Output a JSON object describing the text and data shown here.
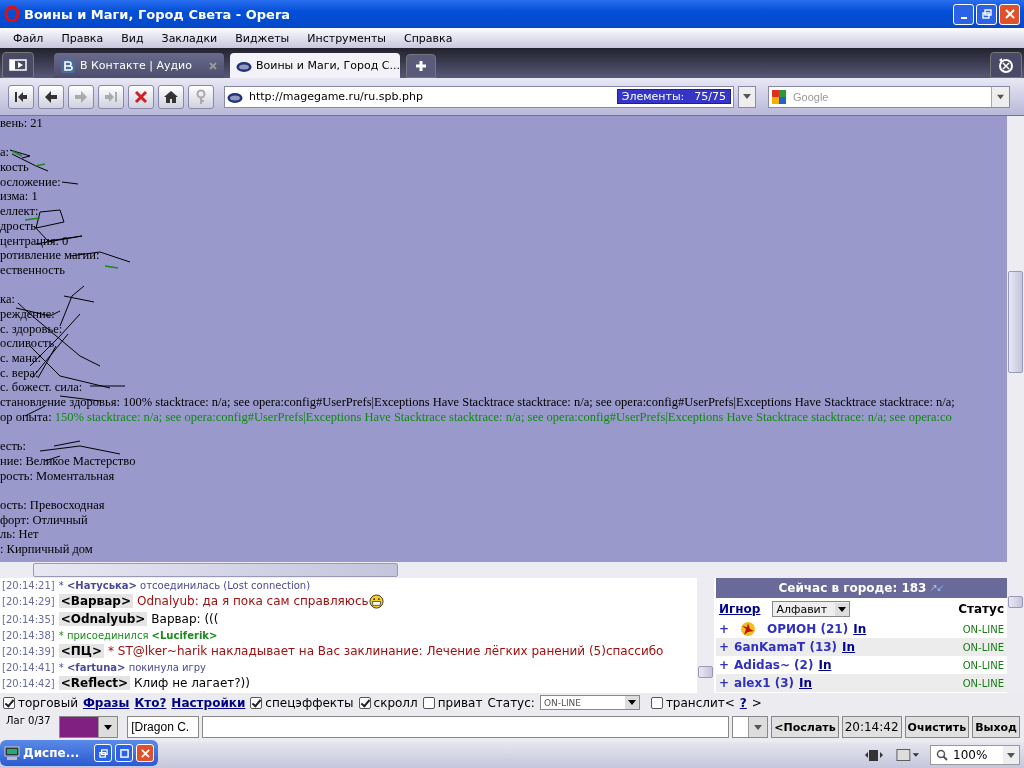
{
  "window": {
    "title": "Воины и Маги, Город Света - Opera"
  },
  "menu": [
    "Файл",
    "Правка",
    "Вид",
    "Закладки",
    "Виджеты",
    "Инструменты",
    "Справка"
  ],
  "tabs": [
    {
      "label": "В Контакте | Аудио",
      "kind": "vk",
      "selected": false
    },
    {
      "label": "Воины и Маги, Город С...",
      "kind": "php",
      "selected": true
    }
  ],
  "toolbar": [
    {
      "kind": "rewind",
      "disabled": false
    },
    {
      "kind": "back",
      "disabled": false
    },
    {
      "kind": "forward",
      "disabled": true
    },
    {
      "kind": "fast-forward",
      "disabled": true
    },
    {
      "kind": "stop",
      "disabled": false
    },
    {
      "kind": "home",
      "disabled": false
    },
    {
      "kind": "key",
      "disabled": true
    }
  ],
  "address": {
    "url": "http://magegame.ru/ru.spb.php",
    "elements_label": "Элементы:",
    "elements_count": "75/75"
  },
  "search": {
    "placeholder": "Google"
  },
  "page": {
    "lines": [
      {
        "kind": "text",
        "text": "вень: 21"
      },
      {
        "kind": "gap"
      },
      {
        "kind": "text",
        "text": "а:"
      },
      {
        "kind": "text",
        "text": "кость"
      },
      {
        "kind": "text",
        "text": "осложение:"
      },
      {
        "kind": "text",
        "text": "изма: 1"
      },
      {
        "kind": "text",
        "text": "еллект:"
      },
      {
        "kind": "text",
        "text": "дрость"
      },
      {
        "kind": "text",
        "text": "центрация: 0"
      },
      {
        "kind": "text",
        "text": "ротивление магии:"
      },
      {
        "kind": "text",
        "text": "ественность"
      },
      {
        "kind": "gap"
      },
      {
        "kind": "text",
        "text": "ка:"
      },
      {
        "kind": "text",
        "text": "реждение:"
      },
      {
        "kind": "text",
        "text": "с. здоровье:"
      },
      {
        "kind": "text",
        "text": "осливость"
      },
      {
        "kind": "text",
        "text": "с. мана:"
      },
      {
        "kind": "text",
        "text": "с. вера:"
      },
      {
        "kind": "text",
        "text": "с. божест. сила:"
      },
      {
        "kind": "text",
        "text": "становление здоровья: 100% stacktrace: n/a; see opera:config#UserPrefs|Exceptions Have Stacktrace stacktrace: n/a; see opera:config#UserPrefs|Exceptions Have Stacktrace stacktrace: n/a;"
      },
      {
        "kind": "valued",
        "text": "ор опыта:",
        "value": "150% stacktrace: n/a; see opera:config#UserPrefs|Exceptions Have Stacktrace stacktrace: n/a; see opera:config#UserPrefs|Exceptions Have Stacktrace stacktrace: n/a; see opera:co"
      },
      {
        "kind": "gap"
      },
      {
        "kind": "text",
        "text": "есть:"
      },
      {
        "kind": "text",
        "text": "ние: Великое Мастерство"
      },
      {
        "kind": "text",
        "text": "рость: Моментальная"
      },
      {
        "kind": "gap"
      },
      {
        "kind": "text",
        "text": "ость: Превосходная"
      },
      {
        "kind": "text",
        "text": "форт: Отличный"
      },
      {
        "kind": "text",
        "text": "ль: Нет"
      },
      {
        "kind": "text",
        "text": ": Кирпичный дом"
      }
    ]
  },
  "chat": [
    {
      "time": "[20:14:21]",
      "kind": "system",
      "text": "* **<Натуська>** отсоединилась (Lost connection)",
      "color": "#4a4a9a",
      "smiley": false
    },
    {
      "time": "[20:14:29]",
      "kind": "message",
      "nick": "<Варвар>",
      "text": "Odnalyub: да я пока сам справляюсь",
      "color": "#a01010",
      "smiley": true
    },
    {
      "time": "[20:14:35]",
      "kind": "message",
      "nick": "<Odnalyub>",
      "text": "Варвар: (((",
      "color": "#000000",
      "smiley": false
    },
    {
      "time": "[20:14:38]",
      "kind": "system",
      "text": "* присоединился **<Luciferik>**",
      "color": "#1a8a1a",
      "smiley": false
    },
    {
      "time": "[20:14:39]",
      "kind": "message",
      "nick": "<ПЦ>",
      "text": "* ST@lker~harik накладывает на Вас заклинание: Лечение лёгких ранений (5)спассибо",
      "color": "#a01010",
      "smiley": false
    },
    {
      "time": "[20:14:41]",
      "kind": "system",
      "text": "* **<fartuna>** покинула игру",
      "color": "#4a4a9a",
      "smiley": false
    },
    {
      "time": "[20:14:42]",
      "kind": "message",
      "nick": "<Reflect>",
      "text": "Клиф не лагает?))",
      "color": "#000000",
      "smiley": false
    }
  ],
  "online": {
    "title": "Сейчас в городе: 183",
    "ignore": "Игнор",
    "sort": "Алфавит",
    "status_heading": "Статус",
    "users": [
      {
        "plus": "+",
        "name": "ОРИОН (21)",
        "link": "In",
        "status": "ON-LINE",
        "emblem": true
      },
      {
        "plus": "+",
        "name": "6anKamaT (13)",
        "link": "In",
        "status": "ON-LINE",
        "emblem": false
      },
      {
        "plus": "+",
        "name": "Adidas~ (2)",
        "link": "In",
        "status": "ON-LINE",
        "emblem": false
      },
      {
        "plus": "+",
        "name": "alex1 (3)",
        "link": "In",
        "status": "ON-LINE",
        "emblem": false
      }
    ]
  },
  "options": {
    "trade": {
      "label": "торговый",
      "checked": true
    },
    "links": [
      "Фразы",
      "Кто?",
      "Настройки"
    ],
    "effects": {
      "label": "спецэффекты",
      "checked": true
    },
    "scroll": {
      "label": "скролл",
      "checked": true
    },
    "private": {
      "label": "приват",
      "checked": false
    },
    "status_label": "Статус:",
    "status_value": "ON-LINE",
    "translit": {
      "label": "транслит<",
      "checked": false
    },
    "help": "?",
    "close_bracket": ">"
  },
  "input_row": {
    "lag": "Лаг 0/37",
    "to_field": "[Dragon C.",
    "send": "<Послать",
    "time": "20:14:42",
    "clear": "Очистить",
    "exit": "Выход"
  },
  "status_bar": {
    "zoom": "100%"
  },
  "taskbar_window": {
    "title": "Диспе..."
  }
}
